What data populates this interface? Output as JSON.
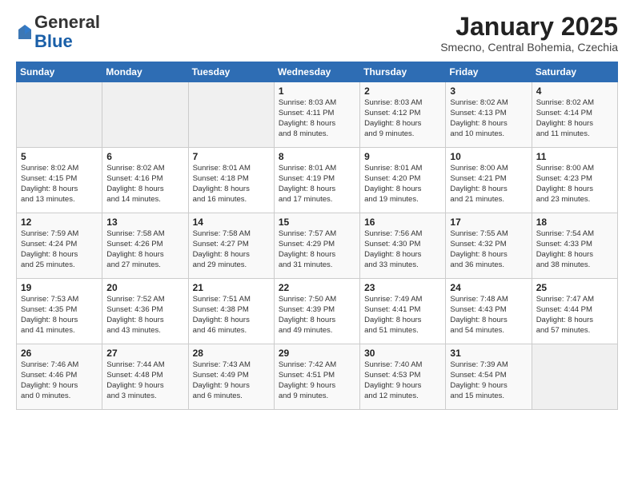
{
  "header": {
    "logo_general": "General",
    "logo_blue": "Blue",
    "month": "January 2025",
    "location": "Smecno, Central Bohemia, Czechia"
  },
  "weekdays": [
    "Sunday",
    "Monday",
    "Tuesday",
    "Wednesday",
    "Thursday",
    "Friday",
    "Saturday"
  ],
  "weeks": [
    [
      {
        "day": "",
        "info": ""
      },
      {
        "day": "",
        "info": ""
      },
      {
        "day": "",
        "info": ""
      },
      {
        "day": "1",
        "info": "Sunrise: 8:03 AM\nSunset: 4:11 PM\nDaylight: 8 hours\nand 8 minutes."
      },
      {
        "day": "2",
        "info": "Sunrise: 8:03 AM\nSunset: 4:12 PM\nDaylight: 8 hours\nand 9 minutes."
      },
      {
        "day": "3",
        "info": "Sunrise: 8:02 AM\nSunset: 4:13 PM\nDaylight: 8 hours\nand 10 minutes."
      },
      {
        "day": "4",
        "info": "Sunrise: 8:02 AM\nSunset: 4:14 PM\nDaylight: 8 hours\nand 11 minutes."
      }
    ],
    [
      {
        "day": "5",
        "info": "Sunrise: 8:02 AM\nSunset: 4:15 PM\nDaylight: 8 hours\nand 13 minutes."
      },
      {
        "day": "6",
        "info": "Sunrise: 8:02 AM\nSunset: 4:16 PM\nDaylight: 8 hours\nand 14 minutes."
      },
      {
        "day": "7",
        "info": "Sunrise: 8:01 AM\nSunset: 4:18 PM\nDaylight: 8 hours\nand 16 minutes."
      },
      {
        "day": "8",
        "info": "Sunrise: 8:01 AM\nSunset: 4:19 PM\nDaylight: 8 hours\nand 17 minutes."
      },
      {
        "day": "9",
        "info": "Sunrise: 8:01 AM\nSunset: 4:20 PM\nDaylight: 8 hours\nand 19 minutes."
      },
      {
        "day": "10",
        "info": "Sunrise: 8:00 AM\nSunset: 4:21 PM\nDaylight: 8 hours\nand 21 minutes."
      },
      {
        "day": "11",
        "info": "Sunrise: 8:00 AM\nSunset: 4:23 PM\nDaylight: 8 hours\nand 23 minutes."
      }
    ],
    [
      {
        "day": "12",
        "info": "Sunrise: 7:59 AM\nSunset: 4:24 PM\nDaylight: 8 hours\nand 25 minutes."
      },
      {
        "day": "13",
        "info": "Sunrise: 7:58 AM\nSunset: 4:26 PM\nDaylight: 8 hours\nand 27 minutes."
      },
      {
        "day": "14",
        "info": "Sunrise: 7:58 AM\nSunset: 4:27 PM\nDaylight: 8 hours\nand 29 minutes."
      },
      {
        "day": "15",
        "info": "Sunrise: 7:57 AM\nSunset: 4:29 PM\nDaylight: 8 hours\nand 31 minutes."
      },
      {
        "day": "16",
        "info": "Sunrise: 7:56 AM\nSunset: 4:30 PM\nDaylight: 8 hours\nand 33 minutes."
      },
      {
        "day": "17",
        "info": "Sunrise: 7:55 AM\nSunset: 4:32 PM\nDaylight: 8 hours\nand 36 minutes."
      },
      {
        "day": "18",
        "info": "Sunrise: 7:54 AM\nSunset: 4:33 PM\nDaylight: 8 hours\nand 38 minutes."
      }
    ],
    [
      {
        "day": "19",
        "info": "Sunrise: 7:53 AM\nSunset: 4:35 PM\nDaylight: 8 hours\nand 41 minutes."
      },
      {
        "day": "20",
        "info": "Sunrise: 7:52 AM\nSunset: 4:36 PM\nDaylight: 8 hours\nand 43 minutes."
      },
      {
        "day": "21",
        "info": "Sunrise: 7:51 AM\nSunset: 4:38 PM\nDaylight: 8 hours\nand 46 minutes."
      },
      {
        "day": "22",
        "info": "Sunrise: 7:50 AM\nSunset: 4:39 PM\nDaylight: 8 hours\nand 49 minutes."
      },
      {
        "day": "23",
        "info": "Sunrise: 7:49 AM\nSunset: 4:41 PM\nDaylight: 8 hours\nand 51 minutes."
      },
      {
        "day": "24",
        "info": "Sunrise: 7:48 AM\nSunset: 4:43 PM\nDaylight: 8 hours\nand 54 minutes."
      },
      {
        "day": "25",
        "info": "Sunrise: 7:47 AM\nSunset: 4:44 PM\nDaylight: 8 hours\nand 57 minutes."
      }
    ],
    [
      {
        "day": "26",
        "info": "Sunrise: 7:46 AM\nSunset: 4:46 PM\nDaylight: 9 hours\nand 0 minutes."
      },
      {
        "day": "27",
        "info": "Sunrise: 7:44 AM\nSunset: 4:48 PM\nDaylight: 9 hours\nand 3 minutes."
      },
      {
        "day": "28",
        "info": "Sunrise: 7:43 AM\nSunset: 4:49 PM\nDaylight: 9 hours\nand 6 minutes."
      },
      {
        "day": "29",
        "info": "Sunrise: 7:42 AM\nSunset: 4:51 PM\nDaylight: 9 hours\nand 9 minutes."
      },
      {
        "day": "30",
        "info": "Sunrise: 7:40 AM\nSunset: 4:53 PM\nDaylight: 9 hours\nand 12 minutes."
      },
      {
        "day": "31",
        "info": "Sunrise: 7:39 AM\nSunset: 4:54 PM\nDaylight: 9 hours\nand 15 minutes."
      },
      {
        "day": "",
        "info": ""
      }
    ]
  ]
}
